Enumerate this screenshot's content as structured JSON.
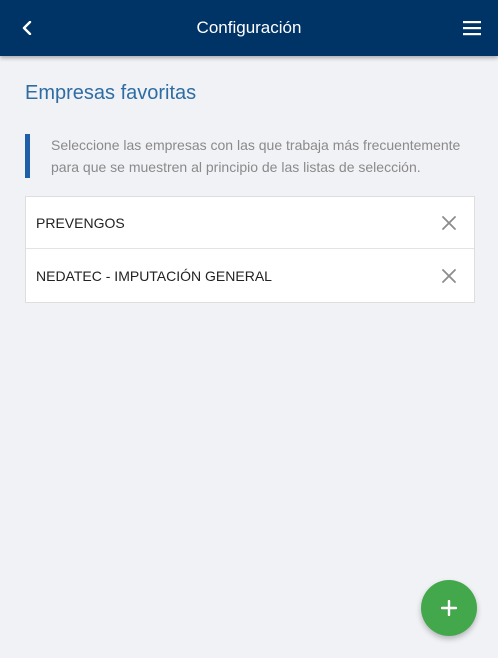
{
  "header": {
    "title": "Configuración",
    "back_icon": "chevron-left-icon",
    "menu_icon": "hamburger-menu-icon",
    "background": "#003366"
  },
  "section": {
    "title": "Empresas favoritas",
    "description": "Seleccione las empresas con las que trabaja más frecuentemente para que se muestren al principio de las listas de selección."
  },
  "favorites": [
    {
      "name": "PREVENGOS",
      "remove_icon": "close-icon"
    },
    {
      "name": "NEDATEC - IMPUTACIÓN GENERAL",
      "remove_icon": "close-icon"
    }
  ],
  "fab": {
    "icon": "plus-icon",
    "color": "#43a84b"
  }
}
